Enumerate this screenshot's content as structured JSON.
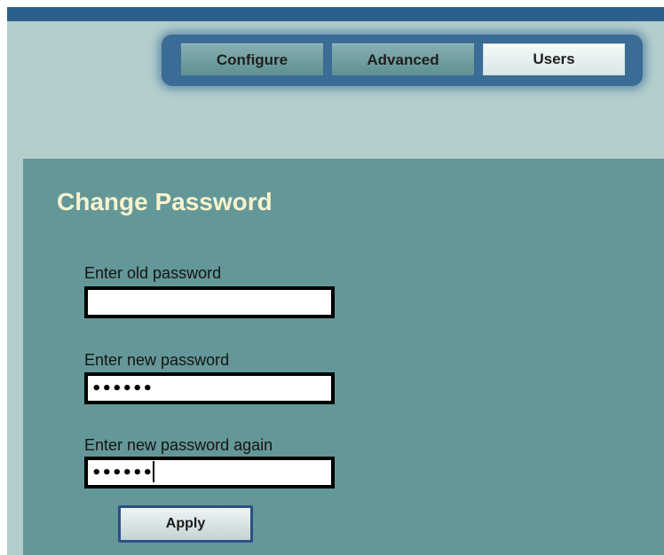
{
  "nav": {
    "tabs": [
      {
        "label": "Configure",
        "active": false
      },
      {
        "label": "Advanced",
        "active": false
      },
      {
        "label": "Users",
        "active": true
      }
    ]
  },
  "page": {
    "title": "Change Password"
  },
  "form": {
    "old_password": {
      "label": "Enter old password",
      "value": ""
    },
    "new_password": {
      "label": "Enter new password",
      "value": "••••••"
    },
    "confirm_password": {
      "label": "Enter new password again",
      "value": "••••••"
    },
    "apply_label": "Apply"
  },
  "colors": {
    "top_bar": "#2d5f8d",
    "header_background": "#b4cece",
    "content_background": "#649798",
    "title_text": "#f7f3cc",
    "nav_frame": "#3a6c96"
  }
}
